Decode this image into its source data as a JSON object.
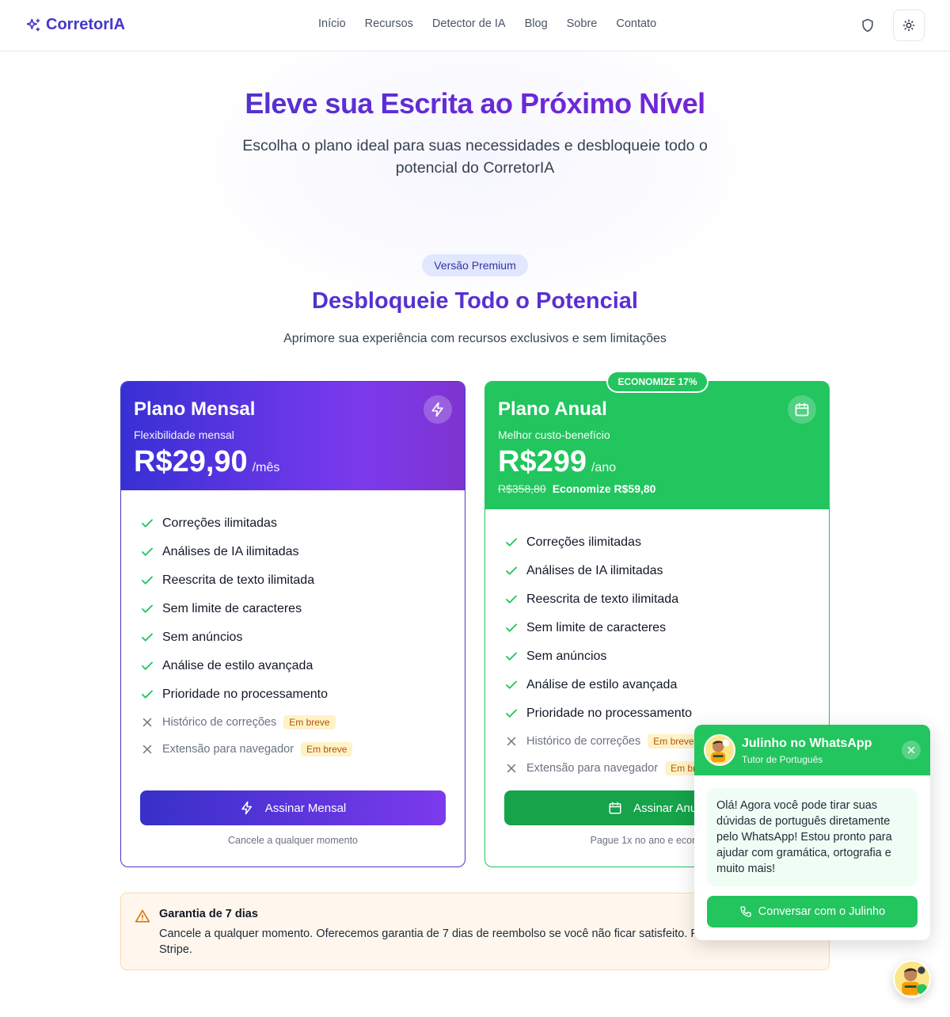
{
  "header": {
    "logo_text": "CorretorIA",
    "nav": [
      "Início",
      "Recursos",
      "Detector de IA",
      "Blog",
      "Sobre",
      "Contato"
    ],
    "icons": [
      "shield-icon",
      "sun-icon"
    ]
  },
  "hero": {
    "title": "Eleve sua Escrita ao Próximo Nível",
    "subtitle": "Escolha o plano ideal para suas necessidades e desbloqueie todo o potencial do CorretorIA"
  },
  "premium": {
    "badge": "Versão Premium",
    "title": "Desbloqueie Todo o Potencial",
    "subtitle": "Aprimore sua experiência com recursos exclusivos e sem limitações"
  },
  "plans": {
    "monthly": {
      "name": "Plano Mensal",
      "tagline": "Flexibilidade mensal",
      "price": "R$29,90",
      "period": "/mês",
      "icon": "lightning-icon",
      "features": [
        "Correções ilimitadas",
        "Análises de IA ilimitadas",
        "Reescrita de texto ilimitada",
        "Sem limite de caracteres",
        "Sem anúncios",
        "Análise de estilo avançada",
        "Prioridade no processamento"
      ],
      "unavailable": [
        {
          "label": "Histórico de correções",
          "badge": "Em breve"
        },
        {
          "label": "Extensão para navegador",
          "badge": "Em breve"
        }
      ],
      "cta": "Assinar Mensal",
      "note": "Cancele a qualquer momento",
      "accent": "#4338ca"
    },
    "annual": {
      "ribbon": "ECONOMIZE 17%",
      "name": "Plano Anual",
      "tagline": "Melhor custo-benefício",
      "price": "R$299",
      "period": "/ano",
      "old_price": "R$358,80",
      "saving": "Economize R$59,80",
      "icon": "calendar-icon",
      "features": [
        "Correções ilimitadas",
        "Análises de IA ilimitadas",
        "Reescrita de texto ilimitada",
        "Sem limite de caracteres",
        "Sem anúncios",
        "Análise de estilo avançada",
        "Prioridade no processamento"
      ],
      "unavailable": [
        {
          "label": "Histórico de correções",
          "badge": "Em breve"
        },
        {
          "label": "Extensão para navegador",
          "badge": "Em breve"
        }
      ],
      "cta": "Assinar Anual",
      "note": "Pague 1x no ano e economize",
      "accent": "#22c55e"
    }
  },
  "guarantee": {
    "title": "Garantia de 7 dias",
    "text": "Cancele a qualquer momento. Oferecemos garantia de 7 dias de reembolso se você não ficar satisfeito. Pagamento seguro via Stripe."
  },
  "whatsapp": {
    "name": "Julinho no WhatsApp",
    "role": "Tutor de Português",
    "message": "Olá! Agora você pode tirar suas dúvidas de português diretamente pelo WhatsApp! Estou pronto para ajudar com gramática, ortografia e muito mais!",
    "cta": "Conversar com o Julinho",
    "color": "#22c55e"
  }
}
